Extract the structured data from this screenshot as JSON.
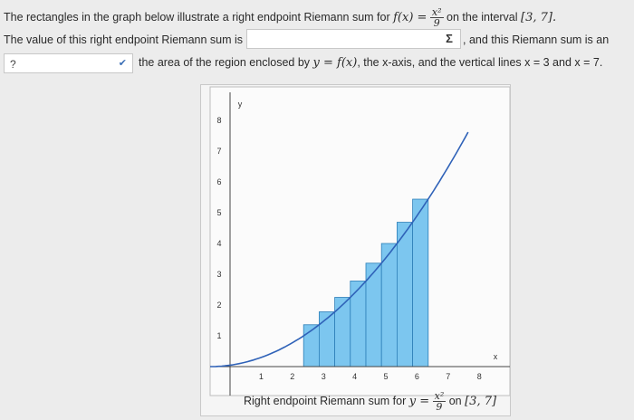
{
  "question": {
    "line1_before": "The rectangles in the graph below illustrate a right endpoint Riemann sum for",
    "function_lhs": "f(x) =",
    "frac_num": "x²",
    "frac_den": "9",
    "line1_after": "on the interval",
    "interval": "[3, 7].",
    "line2_before": "The value of this right endpoint Riemann sum is",
    "line2_after": ", and this Riemann sum is an",
    "line3_after_pre": "the area of the region enclosed by",
    "line3_math1": "y = f(x)",
    "line3_after_post": ", the x-axis, and the vertical lines x = 3 and x = 7."
  },
  "answer_input": {
    "value": "",
    "button_icon": "Σ"
  },
  "select": {
    "value": "?",
    "icon": "chevron-down-icon"
  },
  "colors": {
    "bar_fill": "#7cc6ef",
    "bar_stroke": "#2d7fb8",
    "curve": "#2f62b8"
  },
  "chart_data": {
    "type": "bar",
    "function": "x^2/9",
    "x_ticks": [
      "1",
      "2",
      "3",
      "4",
      "5",
      "6",
      "7",
      "8"
    ],
    "y_ticks": [
      "1",
      "2",
      "3",
      "4",
      "5",
      "6",
      "7",
      "8"
    ],
    "ylabel": "y",
    "xlabel": "x",
    "xlim": [
      0,
      8.3
    ],
    "ylim": [
      0,
      9
    ],
    "bars": [
      {
        "x_left": 3.0,
        "x_right": 3.5,
        "height": 1.36
      },
      {
        "x_left": 3.5,
        "x_right": 4.0,
        "height": 1.78
      },
      {
        "x_left": 4.0,
        "x_right": 4.5,
        "height": 2.25
      },
      {
        "x_left": 4.5,
        "x_right": 5.0,
        "height": 2.78
      },
      {
        "x_left": 5.0,
        "x_right": 5.5,
        "height": 3.36
      },
      {
        "x_left": 5.5,
        "x_right": 6.0,
        "height": 4.0
      },
      {
        "x_left": 6.0,
        "x_right": 6.5,
        "height": 4.69
      },
      {
        "x_left": 6.5,
        "x_right": 7.0,
        "height": 5.44
      }
    ]
  },
  "caption": {
    "before": "Right endpoint Riemann sum for",
    "math": "y =",
    "frac_num": "x²",
    "frac_den": "9",
    "after": "on",
    "interval": "[3, 7]"
  }
}
